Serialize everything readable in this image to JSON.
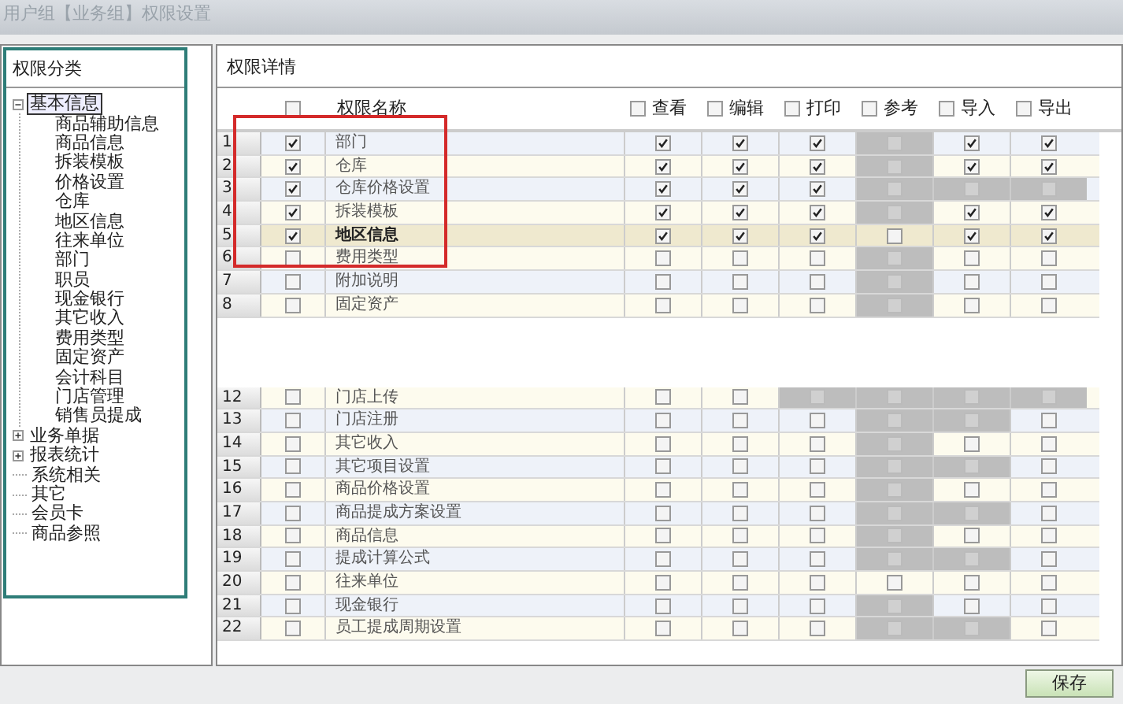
{
  "window": {
    "title": "用户组【业务组】权限设置"
  },
  "category_panel": {
    "title": "权限分类",
    "tree": [
      {
        "label": "基本信息",
        "expanded": true,
        "selected": true,
        "children": [
          {
            "label": "商品辅助信息"
          },
          {
            "label": "商品信息"
          },
          {
            "label": "拆装模板"
          },
          {
            "label": "价格设置"
          },
          {
            "label": "仓库"
          },
          {
            "label": "地区信息"
          },
          {
            "label": "往来单位"
          },
          {
            "label": "部门"
          },
          {
            "label": "职员"
          },
          {
            "label": "现金银行"
          },
          {
            "label": "其它收入"
          },
          {
            "label": "费用类型"
          },
          {
            "label": "固定资产"
          },
          {
            "label": "会计科目"
          },
          {
            "label": "门店管理"
          },
          {
            "label": "销售员提成"
          }
        ]
      },
      {
        "label": "业务单据",
        "expanded": false,
        "selected": false
      },
      {
        "label": "报表统计",
        "expanded": false,
        "selected": false
      },
      {
        "label": "系统相关",
        "selected": false
      },
      {
        "label": "其它",
        "selected": false
      },
      {
        "label": "会员卡",
        "selected": false
      },
      {
        "label": "商品参照",
        "selected": false
      }
    ]
  },
  "detail_panel": {
    "title": "权限详情",
    "columns": [
      {
        "label": "权限名称",
        "checked": false
      },
      {
        "label": "查看",
        "checked": false
      },
      {
        "label": "编辑",
        "checked": false
      },
      {
        "label": "打印",
        "checked": false
      },
      {
        "label": "参考",
        "checked": false
      },
      {
        "label": "导入",
        "checked": false
      },
      {
        "label": "导出",
        "checked": false
      }
    ],
    "rows": [
      {
        "number": "1",
        "name": "部门",
        "checked": true,
        "selected": false,
        "cells": [
          {
            "checked": true,
            "disabled": false
          },
          {
            "checked": true,
            "disabled": false
          },
          {
            "checked": true,
            "disabled": false
          },
          {
            "checked": false,
            "disabled": true
          },
          {
            "checked": true,
            "disabled": false
          },
          {
            "checked": true,
            "disabled": false
          }
        ]
      },
      {
        "number": "2",
        "name": "仓库",
        "checked": true,
        "selected": false,
        "cells": [
          {
            "checked": true,
            "disabled": false
          },
          {
            "checked": true,
            "disabled": false
          },
          {
            "checked": true,
            "disabled": false
          },
          {
            "checked": false,
            "disabled": true
          },
          {
            "checked": true,
            "disabled": false
          },
          {
            "checked": true,
            "disabled": false
          }
        ]
      },
      {
        "number": "3",
        "name": "仓库价格设置",
        "checked": true,
        "selected": false,
        "cells": [
          {
            "checked": true,
            "disabled": false
          },
          {
            "checked": true,
            "disabled": false
          },
          {
            "checked": true,
            "disabled": false
          },
          {
            "checked": false,
            "disabled": true
          },
          {
            "checked": false,
            "disabled": true
          },
          {
            "checked": false,
            "disabled": true
          }
        ]
      },
      {
        "number": "4",
        "name": "拆装模板",
        "checked": true,
        "selected": false,
        "cells": [
          {
            "checked": true,
            "disabled": false
          },
          {
            "checked": true,
            "disabled": false
          },
          {
            "checked": true,
            "disabled": false
          },
          {
            "checked": false,
            "disabled": true
          },
          {
            "checked": true,
            "disabled": false
          },
          {
            "checked": true,
            "disabled": false
          }
        ]
      },
      {
        "number": "5",
        "name": "地区信息",
        "checked": true,
        "selected": true,
        "cells": [
          {
            "checked": true,
            "disabled": false
          },
          {
            "checked": true,
            "disabled": false
          },
          {
            "checked": true,
            "disabled": false
          },
          {
            "checked": false,
            "disabled": false
          },
          {
            "checked": true,
            "disabled": false
          },
          {
            "checked": true,
            "disabled": false
          }
        ]
      },
      {
        "number": "6",
        "name": "费用类型",
        "checked": false,
        "selected": false,
        "cells": [
          {
            "checked": false,
            "disabled": false
          },
          {
            "checked": false,
            "disabled": false
          },
          {
            "checked": false,
            "disabled": false
          },
          {
            "checked": false,
            "disabled": true
          },
          {
            "checked": false,
            "disabled": false
          },
          {
            "checked": false,
            "disabled": false
          }
        ]
      },
      {
        "number": "7",
        "name": "附加说明",
        "checked": false,
        "selected": false,
        "cells": [
          {
            "checked": false,
            "disabled": false
          },
          {
            "checked": false,
            "disabled": false
          },
          {
            "checked": false,
            "disabled": false
          },
          {
            "checked": false,
            "disabled": true
          },
          {
            "checked": false,
            "disabled": false
          },
          {
            "checked": false,
            "disabled": false
          }
        ]
      },
      {
        "number": "8",
        "name": "固定资产",
        "checked": false,
        "selected": false,
        "cells": [
          {
            "checked": false,
            "disabled": false
          },
          {
            "checked": false,
            "disabled": false
          },
          {
            "checked": false,
            "disabled": false
          },
          {
            "checked": false,
            "disabled": true
          },
          {
            "checked": false,
            "disabled": false
          },
          {
            "checked": false,
            "disabled": false
          }
        ]
      },
      {
        "kind": "hidden"
      },
      {
        "number": "12",
        "name": "门店上传",
        "checked": false,
        "selected": false,
        "cells": [
          {
            "checked": false,
            "disabled": false
          },
          {
            "checked": false,
            "disabled": false
          },
          {
            "checked": false,
            "disabled": true
          },
          {
            "checked": false,
            "disabled": true
          },
          {
            "checked": false,
            "disabled": true
          },
          {
            "checked": false,
            "disabled": true
          }
        ]
      },
      {
        "number": "13",
        "name": "门店注册",
        "checked": false,
        "selected": false,
        "cells": [
          {
            "checked": false,
            "disabled": false
          },
          {
            "checked": false,
            "disabled": false
          },
          {
            "checked": false,
            "disabled": false
          },
          {
            "checked": false,
            "disabled": true
          },
          {
            "checked": false,
            "disabled": true
          },
          {
            "checked": false,
            "disabled": false
          }
        ]
      },
      {
        "number": "14",
        "name": "其它收入",
        "checked": false,
        "selected": false,
        "cells": [
          {
            "checked": false,
            "disabled": false
          },
          {
            "checked": false,
            "disabled": false
          },
          {
            "checked": false,
            "disabled": false
          },
          {
            "checked": false,
            "disabled": true
          },
          {
            "checked": false,
            "disabled": false
          },
          {
            "checked": false,
            "disabled": false
          }
        ]
      },
      {
        "number": "15",
        "name": "其它项目设置",
        "checked": false,
        "selected": false,
        "cells": [
          {
            "checked": false,
            "disabled": false
          },
          {
            "checked": false,
            "disabled": false
          },
          {
            "checked": false,
            "disabled": false
          },
          {
            "checked": false,
            "disabled": true
          },
          {
            "checked": false,
            "disabled": true
          },
          {
            "checked": false,
            "disabled": false
          }
        ]
      },
      {
        "number": "16",
        "name": "商品价格设置",
        "checked": false,
        "selected": false,
        "cells": [
          {
            "checked": false,
            "disabled": false
          },
          {
            "checked": false,
            "disabled": false
          },
          {
            "checked": false,
            "disabled": false
          },
          {
            "checked": false,
            "disabled": true
          },
          {
            "checked": false,
            "disabled": false
          },
          {
            "checked": false,
            "disabled": false
          }
        ]
      },
      {
        "number": "17",
        "name": "商品提成方案设置",
        "checked": false,
        "selected": false,
        "cells": [
          {
            "checked": false,
            "disabled": false
          },
          {
            "checked": false,
            "disabled": false
          },
          {
            "checked": false,
            "disabled": false
          },
          {
            "checked": false,
            "disabled": true
          },
          {
            "checked": false,
            "disabled": true
          },
          {
            "checked": false,
            "disabled": false
          }
        ]
      },
      {
        "number": "18",
        "name": "商品信息",
        "checked": false,
        "selected": false,
        "cells": [
          {
            "checked": false,
            "disabled": false
          },
          {
            "checked": false,
            "disabled": false
          },
          {
            "checked": false,
            "disabled": false
          },
          {
            "checked": false,
            "disabled": true
          },
          {
            "checked": false,
            "disabled": false
          },
          {
            "checked": false,
            "disabled": false
          }
        ]
      },
      {
        "number": "19",
        "name": "提成计算公式",
        "checked": false,
        "selected": false,
        "cells": [
          {
            "checked": false,
            "disabled": false
          },
          {
            "checked": false,
            "disabled": false
          },
          {
            "checked": false,
            "disabled": false
          },
          {
            "checked": false,
            "disabled": true
          },
          {
            "checked": false,
            "disabled": true
          },
          {
            "checked": false,
            "disabled": false
          }
        ]
      },
      {
        "number": "20",
        "name": "往来单位",
        "checked": false,
        "selected": false,
        "cells": [
          {
            "checked": false,
            "disabled": false
          },
          {
            "checked": false,
            "disabled": false
          },
          {
            "checked": false,
            "disabled": false
          },
          {
            "checked": false,
            "disabled": false
          },
          {
            "checked": false,
            "disabled": false
          },
          {
            "checked": false,
            "disabled": false
          }
        ]
      },
      {
        "number": "21",
        "name": "现金银行",
        "checked": false,
        "selected": false,
        "cells": [
          {
            "checked": false,
            "disabled": false
          },
          {
            "checked": false,
            "disabled": false
          },
          {
            "checked": false,
            "disabled": false
          },
          {
            "checked": false,
            "disabled": true
          },
          {
            "checked": false,
            "disabled": false
          },
          {
            "checked": false,
            "disabled": false
          }
        ]
      },
      {
        "number": "22",
        "name": "员工提成周期设置",
        "checked": false,
        "selected": false,
        "cells": [
          {
            "checked": false,
            "disabled": false
          },
          {
            "checked": false,
            "disabled": false
          },
          {
            "checked": false,
            "disabled": false
          },
          {
            "checked": false,
            "disabled": true
          },
          {
            "checked": false,
            "disabled": true
          },
          {
            "checked": false,
            "disabled": false
          }
        ]
      }
    ]
  },
  "buttons": [
    {
      "label": "保存"
    }
  ]
}
